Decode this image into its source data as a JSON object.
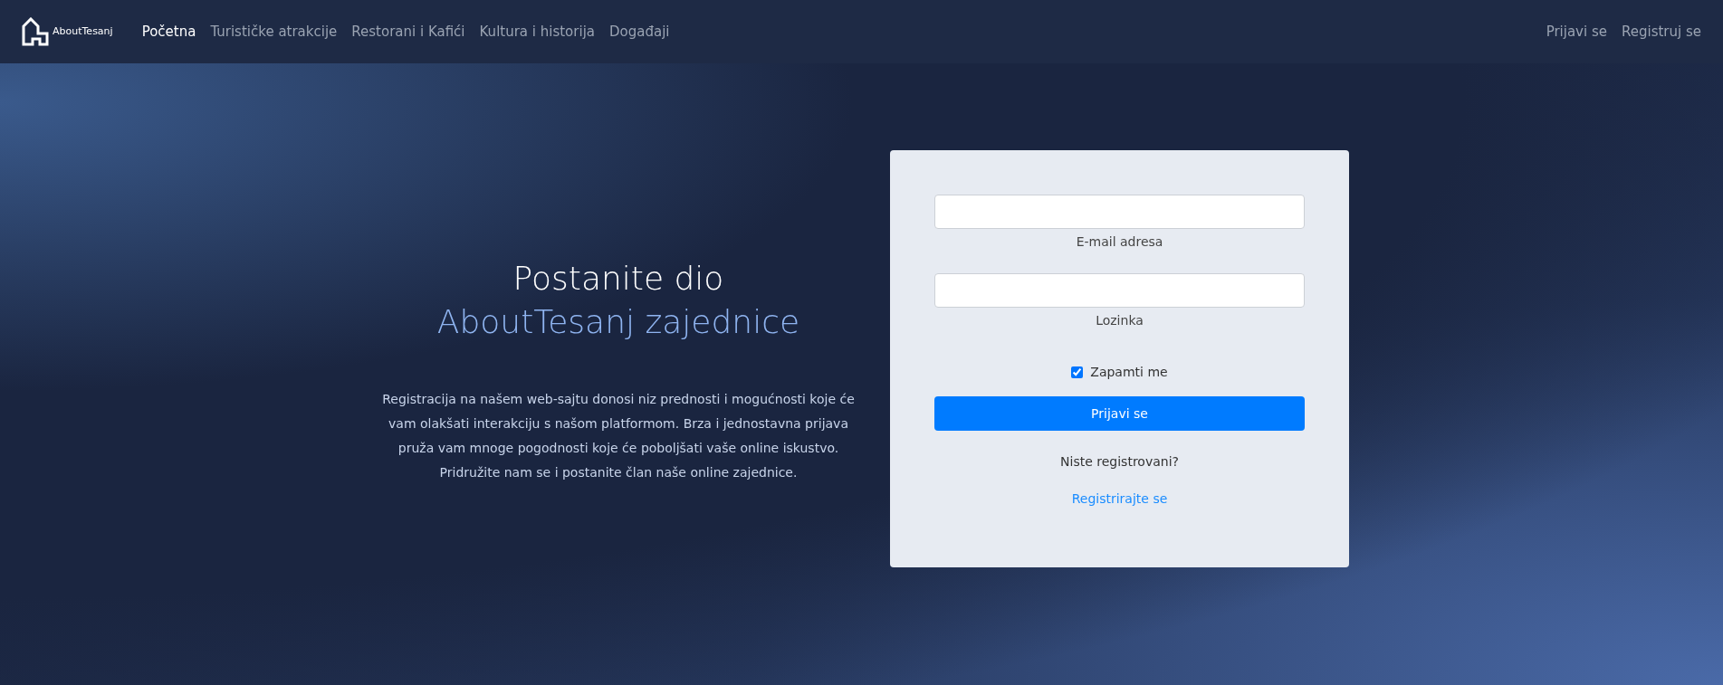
{
  "navbar": {
    "brand": "AboutTesanj",
    "links": [
      {
        "label": "Početna",
        "selected": true
      },
      {
        "label": "Turističke atrakcije",
        "selected": false
      },
      {
        "label": "Restorani i Kafići",
        "selected": false
      },
      {
        "label": "Kultura i historija",
        "selected": false
      },
      {
        "label": "Događaji",
        "selected": false
      }
    ],
    "auth_links": [
      "Prijavi se",
      "Registruj se"
    ]
  },
  "hero": {
    "title": "Postanite dio",
    "title_highlight": "AboutTesanj zajednice",
    "description": "Registracija na našem web-sajtu donosi niz prednosti i mogućnosti koje će vam olakšati interakciju s našom platformom. Brza i jednostavna prijava pruža vam mnoge pogodnosti koje će poboljšati vaše online iskustvo. Pridružite nam se i postanite član naše online zajednice."
  },
  "login_form": {
    "fields": [
      {
        "label": "E-mail adresa"
      },
      {
        "label": "Lozinka"
      }
    ],
    "remember": {
      "label": "Zapamti me",
      "checked": true
    },
    "submit": "Prijavi se",
    "register_prompt": "Niste registrovani?",
    "register_link": "Registrirajte se"
  }
}
